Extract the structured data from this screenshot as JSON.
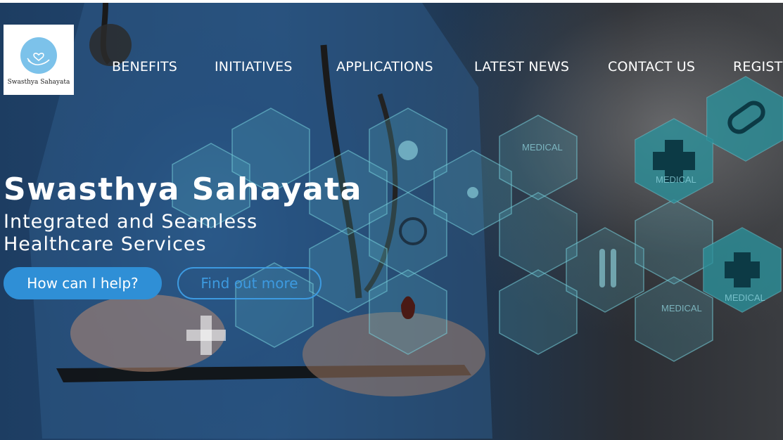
{
  "logo": {
    "text": "Swasthya Sahayata",
    "icon": "heart-hand-icon",
    "accent": "#7cc2ea"
  },
  "nav": {
    "items": [
      {
        "label": "BENEFITS"
      },
      {
        "label": "INITIATIVES"
      },
      {
        "label": "APPLICATIONS"
      },
      {
        "label": "LATEST NEWS"
      },
      {
        "label": "CONTACT US"
      },
      {
        "label": "REGIST"
      }
    ]
  },
  "hero": {
    "title": "Swasthya Sahayata",
    "subtitle": "Integrated and Seamless Healthcare Services",
    "primary_button": "How can I help?",
    "secondary_button": "Find out more",
    "background_labels": [
      "MEDICAL",
      "MEDICAL",
      "MEDICAL",
      "MEDICAL"
    ]
  },
  "colors": {
    "primary": "#2f8fd6",
    "outline": "#3d9ae0",
    "hex_teal": "#2e7f8c"
  }
}
